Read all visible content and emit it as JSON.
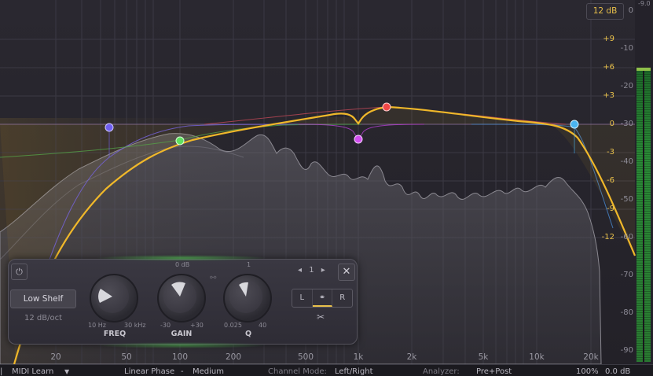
{
  "range_button": "12 dB",
  "top_meter_reading": "-9.0",
  "gain_scale": [
    "+9",
    "+6",
    "+3",
    "0",
    "-3",
    "-6",
    "-9",
    "-12"
  ],
  "db_scale": [
    "0",
    "-10",
    "-20",
    "-30",
    "-40",
    "-50",
    "-60",
    "-70",
    "-80",
    "-90"
  ],
  "freq_scale": [
    "20",
    "50",
    "100",
    "200",
    "500",
    "1k",
    "2k",
    "5k",
    "10k",
    "20k"
  ],
  "band_panel": {
    "shape": "Low Shelf",
    "slope": "12 dB/oct",
    "band_number": "1",
    "knobs": {
      "freq": {
        "label": "FREQ",
        "min": "10 Hz",
        "max": "30 kHz"
      },
      "gain": {
        "label": "GAIN",
        "min": "-30",
        "max": "+30",
        "top": "0 dB"
      },
      "q": {
        "label": "Q",
        "min": "0.025",
        "max": "40",
        "top": "1"
      }
    },
    "stereo": [
      "L",
      "⚭",
      "R"
    ]
  },
  "bottom_bar": {
    "midi_learn": "MIDI Learn",
    "linear_phase_label": "Linear Phase",
    "linear_phase_sep": "-",
    "linear_phase_value": "Medium",
    "channel_mode_label": "Channel Mode:",
    "channel_mode_value": "Left/Right",
    "analyzer_label": "Analyzer:",
    "analyzer_value": "Pre+Post",
    "zoom": "100%",
    "output_gain": "0.0 dB"
  },
  "colors": {
    "curve": "#f0b82a",
    "band1": "#6f5ff0",
    "band2": "#5fe05f",
    "band3": "#d34ff0",
    "band4": "#f04848",
    "band5": "#4ab4f0"
  }
}
